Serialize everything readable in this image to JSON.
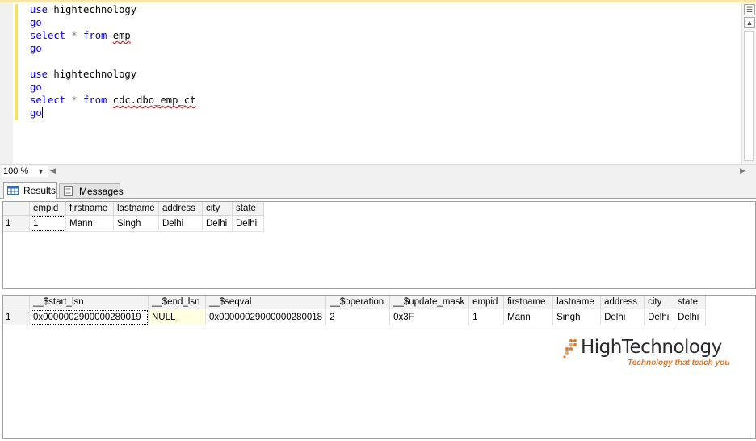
{
  "editor": {
    "lines": [
      {
        "kw": "use",
        "rest": " hightechnology"
      },
      {
        "kw": "go"
      },
      {
        "kw": "select",
        "op": " * ",
        "kw2": "from",
        "obj": "emp"
      },
      {
        "kw": "go"
      },
      {},
      {
        "kw": "use",
        "rest": " hightechnology"
      },
      {
        "kw": "go"
      },
      {
        "kw": "select",
        "op": " * ",
        "kw2": "from",
        "obj": "cdc.dbo_emp_ct"
      },
      {
        "kw": "go"
      }
    ]
  },
  "zoom": {
    "value": "100 %"
  },
  "tabs": {
    "results": "Results",
    "messages": "Messages"
  },
  "grid1": {
    "columns": [
      "empid",
      "firstname",
      "lastname",
      "address",
      "city",
      "state"
    ],
    "rows": [
      {
        "n": "1",
        "cells": [
          "1",
          "Mann",
          "Singh",
          "Delhi",
          "Delhi",
          "Delhi"
        ]
      }
    ]
  },
  "grid2": {
    "columns": [
      "__$start_lsn",
      "__$end_lsn",
      "__$seqval",
      "__$operation",
      "__$update_mask",
      "empid",
      "firstname",
      "lastname",
      "address",
      "city",
      "state"
    ],
    "rows": [
      {
        "n": "1",
        "cells": [
          "0x0000002900000280019",
          "NULL",
          "0x00000029000000280018",
          "2",
          "0x3F",
          "1",
          "Mann",
          "Singh",
          "Delhi",
          "Delhi",
          "Delhi"
        ]
      }
    ]
  },
  "logo": {
    "name": "HighTechnology",
    "tagline": "Technology that teach you"
  },
  "colors": {
    "keyword": "#0000ff",
    "operator": "#808080",
    "squiggle": "#e02020",
    "null_cell": "#ffffe1",
    "logo_accent": "#e87722"
  }
}
